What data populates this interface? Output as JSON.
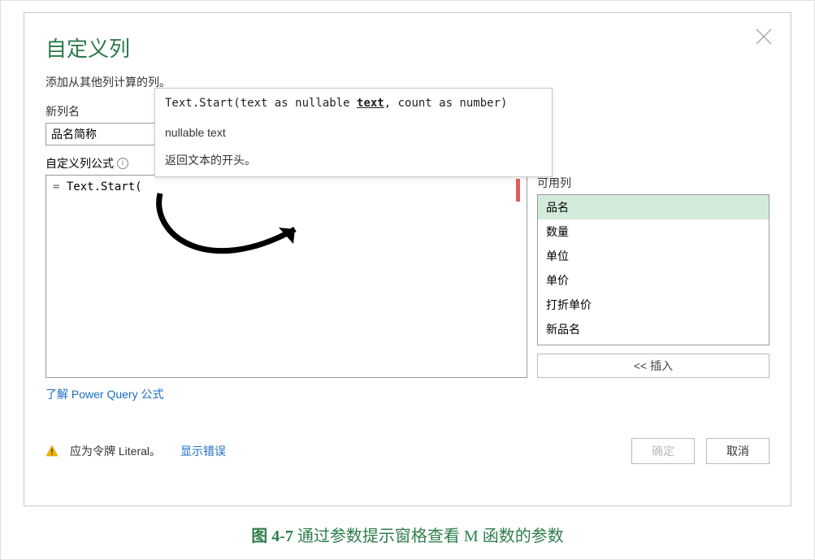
{
  "dialog": {
    "title": "自定义列",
    "subtitle": "添加从其他列计算的列。",
    "close_icon": "close-icon",
    "newColumnNameLabel": "新列名",
    "newColumnNameValue": "品名简称",
    "formulaLabel": "自定义列公式",
    "formulaPrefix": "= ",
    "formulaText": "Text.Start(",
    "availableColumnsLabel": "可用列",
    "availableColumns": [
      "品名",
      "数量",
      "单位",
      "单价",
      "打折单价",
      "新品名"
    ],
    "selectedColumnIndex": 0,
    "insertButtonLabel": "<< 插入",
    "learnLink": "了解 Power Query 公式",
    "warningText": "应为令牌 Literal。",
    "showErrorsLink": "显示错误",
    "okButton": "确定",
    "cancelButton": "取消"
  },
  "tooltip": {
    "signaturePrefix": "Text.Start(text as nullable ",
    "signatureBoldUnderline": "text",
    "signatureSuffix": ", count as number)",
    "returnType": "nullable text",
    "description": "返回文本的开头。"
  },
  "figureCaption": {
    "prefix": "图 4-7",
    "text": "  通过参数提示窗格查看 M 函数的参数"
  }
}
